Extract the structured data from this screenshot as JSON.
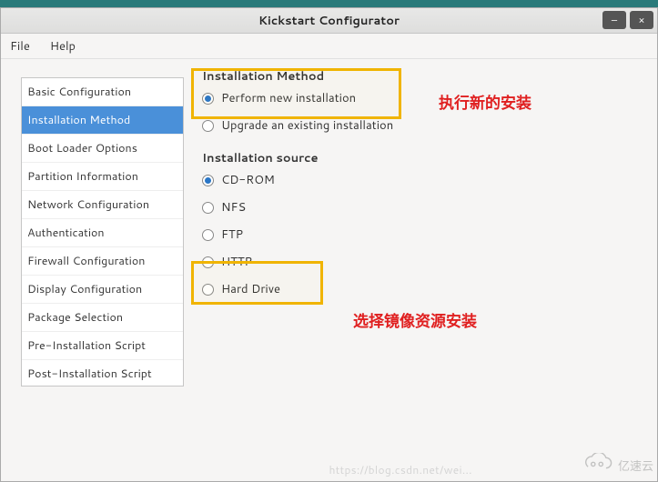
{
  "window": {
    "title": "Kickstart Configurator",
    "minimize": "–",
    "close": "×"
  },
  "menubar": {
    "file": "File",
    "help": "Help"
  },
  "sidebar": {
    "items": [
      {
        "label": "Basic Configuration"
      },
      {
        "label": "Installation Method"
      },
      {
        "label": "Boot Loader Options"
      },
      {
        "label": "Partition Information"
      },
      {
        "label": "Network Configuration"
      },
      {
        "label": "Authentication"
      },
      {
        "label": "Firewall Configuration"
      },
      {
        "label": "Display Configuration"
      },
      {
        "label": "Package Selection"
      },
      {
        "label": "Pre-Installation Script"
      },
      {
        "label": "Post-Installation Script"
      }
    ],
    "selected_index": 1
  },
  "content": {
    "install_method": {
      "title": "Installation Method",
      "options": {
        "perform_new": "Perform new installation",
        "upgrade": "Upgrade an existing installation"
      },
      "selected": "perform_new"
    },
    "install_source": {
      "title": "Installation source",
      "options": {
        "cdrom": "CD-ROM",
        "nfs": "NFS",
        "ftp": "FTP",
        "http": "HTTP",
        "harddrive": "Hard Drive"
      },
      "selected": "cdrom"
    }
  },
  "annotations": {
    "a1": "执行新的安装",
    "a2": "选择镜像资源安装"
  },
  "watermark": {
    "url_fragment": "https://blog.csdn.net/wei...",
    "brand": "亿速云"
  }
}
